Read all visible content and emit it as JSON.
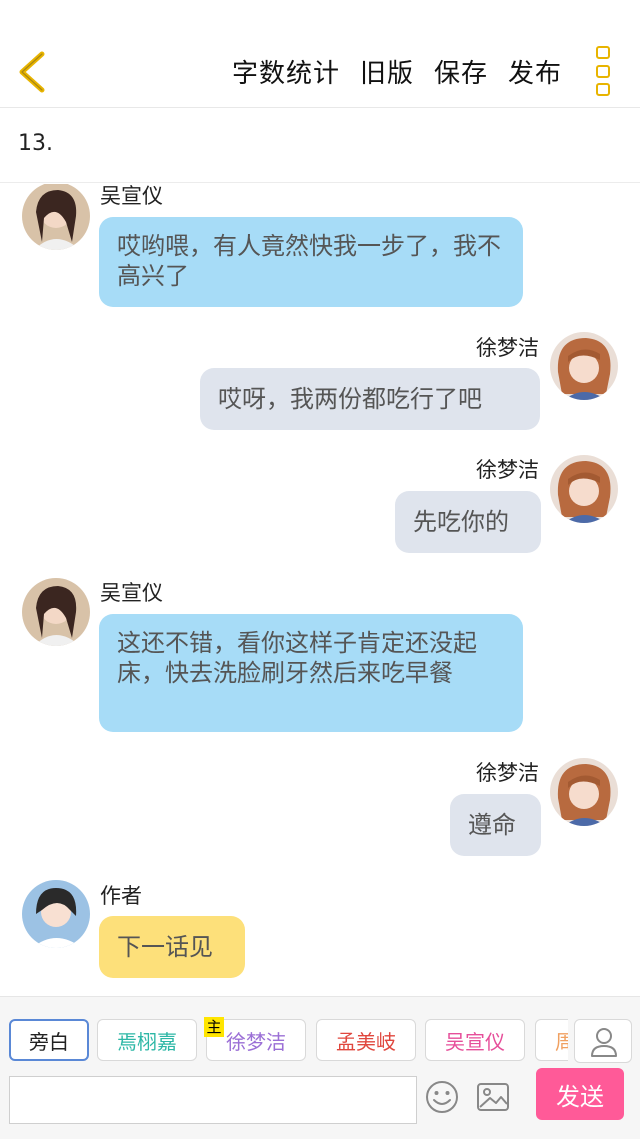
{
  "header": {
    "actions": [
      "字数统计",
      "旧版",
      "保存",
      "发布"
    ],
    "accent_color": "#e8b400"
  },
  "chapter": {
    "title": "13."
  },
  "messages": [
    {
      "side": "left",
      "speaker": "吴宣仪",
      "text": "哎哟喂，有人竟然快我一步了，我不高兴了",
      "bubble": "blue",
      "avatar": "avatar-wu"
    },
    {
      "side": "right",
      "speaker": "徐梦洁",
      "text": "哎呀，我两份都吃行了吧",
      "bubble": "gray",
      "avatar": "avatar-xu"
    },
    {
      "side": "right",
      "speaker": "徐梦洁",
      "text": "先吃你的",
      "bubble": "gray",
      "avatar": "avatar-xu"
    },
    {
      "side": "left",
      "speaker": "吴宣仪",
      "text": "这还不错，看你这样子肯定还没起床，快去洗脸刷牙然后来吃早餐",
      "bubble": "blue",
      "avatar": "avatar-wu"
    },
    {
      "side": "right",
      "speaker": "徐梦洁",
      "text": "遵命",
      "bubble": "gray",
      "avatar": "avatar-xu"
    },
    {
      "side": "left",
      "speaker": "作者",
      "text": "下一话见",
      "bubble": "yellow",
      "avatar": "avatar-author"
    }
  ],
  "roles": [
    {
      "label": "旁白",
      "color": "#222222",
      "active": true
    },
    {
      "label": "焉栩嘉",
      "color": "#2db7a6"
    },
    {
      "label": "徐梦洁",
      "color": "#9b6fd6"
    },
    {
      "label": "孟美岐",
      "color": "#e0473e"
    },
    {
      "label": "吴宣仪",
      "color": "#e64f9a"
    },
    {
      "label": "周",
      "color": "#f0a060"
    }
  ],
  "host_badge": "主",
  "composer": {
    "input_value": "",
    "input_placeholder": "",
    "send_label": "发送",
    "send_color": "#ff5a98"
  },
  "icons": [
    "back-chevron-icon",
    "more-dots-icon",
    "person-icon",
    "emoji-icon",
    "image-icon"
  ]
}
